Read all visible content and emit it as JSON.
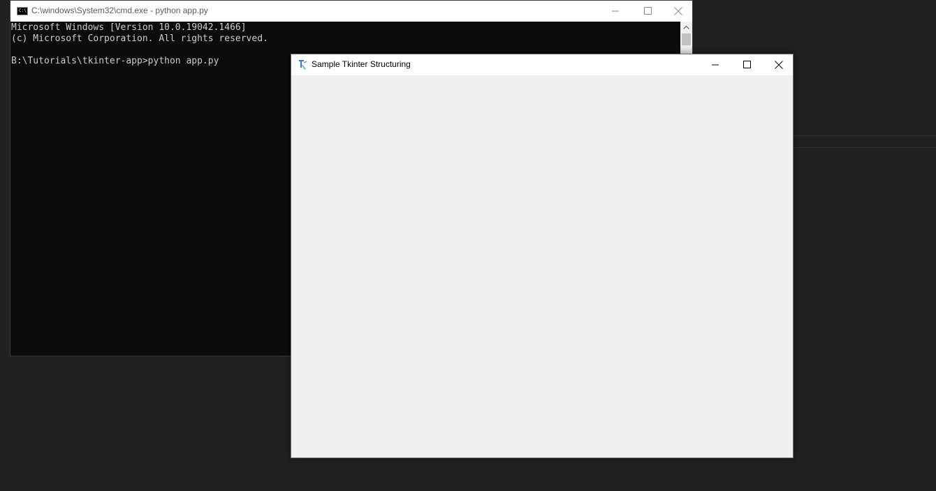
{
  "cmd": {
    "title": "C:\\windows\\System32\\cmd.exe - python  app.py",
    "icon_text": "C:\\",
    "lines": [
      "Microsoft Windows [Version 10.0.19042.1466]",
      "(c) Microsoft Corporation. All rights reserved.",
      "",
      "B:\\Tutorials\\tkinter-app>python app.py"
    ],
    "background": "#0c0c0c",
    "text_color": "#cccccc"
  },
  "tk": {
    "title": "Sample Tkinter Structuring",
    "background": "#efefef"
  },
  "desktop": {
    "background": "#212121"
  }
}
